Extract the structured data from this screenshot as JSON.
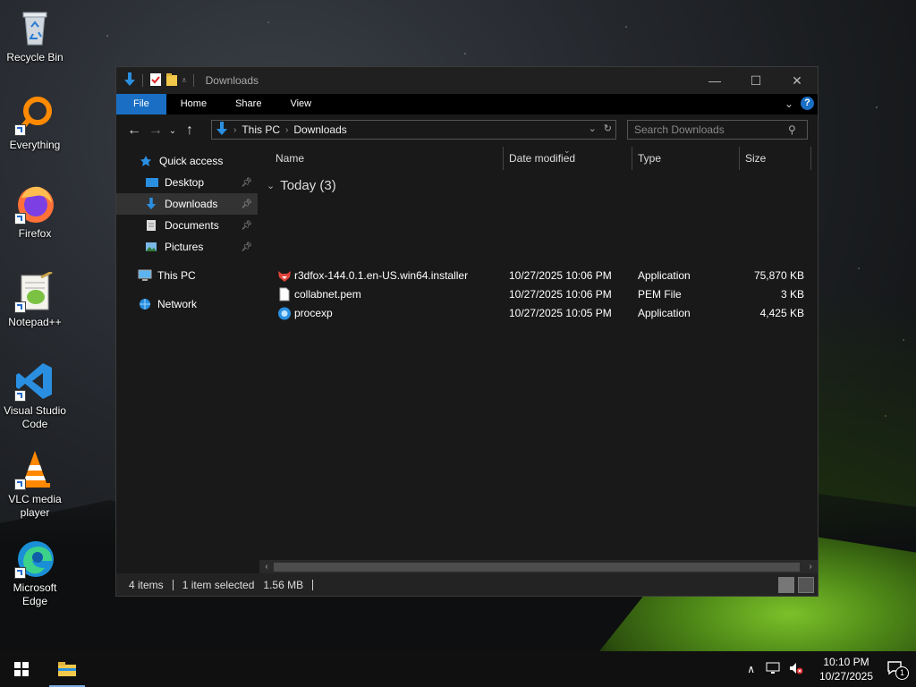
{
  "desktop": {
    "icons": [
      {
        "label": "Recycle Bin"
      },
      {
        "label": "Everything"
      },
      {
        "label": "Firefox"
      },
      {
        "label": "Notepad++"
      },
      {
        "label": "Visual Studio Code"
      },
      {
        "label": "VLC media player"
      },
      {
        "label": "Microsoft Edge"
      }
    ]
  },
  "window": {
    "title": "Downloads",
    "controls": {
      "minimize": "—",
      "maximize": "☐",
      "close": "✕"
    },
    "ribbon_tabs": [
      "File",
      "Home",
      "Share",
      "View"
    ],
    "help": "?",
    "address": {
      "crumbs": [
        "This PC",
        "Downloads"
      ]
    },
    "search": {
      "placeholder": "Search Downloads"
    }
  },
  "nav_pane": {
    "quick_access": "Quick access",
    "items": [
      {
        "label": "Desktop",
        "pinned": true
      },
      {
        "label": "Downloads",
        "pinned": true,
        "selected": true
      },
      {
        "label": "Documents",
        "pinned": true
      },
      {
        "label": "Pictures",
        "pinned": true
      }
    ],
    "this_pc": "This PC",
    "network": "Network"
  },
  "file_list": {
    "columns": {
      "name": "Name",
      "date": "Date modified",
      "type": "Type",
      "size": "Size"
    },
    "group": "Today (3)",
    "rows": [
      {
        "name": "r3dfox-144.0.1.en-US.win64.installer",
        "date": "10/27/2025 10:06 PM",
        "type": "Application",
        "size": "75,870 KB",
        "icon": "fox-installer-icon"
      },
      {
        "name": "collabnet.pem",
        "date": "10/27/2025 10:06 PM",
        "type": "PEM File",
        "size": "3 KB",
        "icon": "document-icon"
      },
      {
        "name": "procexp",
        "date": "10/27/2025 10:05 PM",
        "type": "Application",
        "size": "4,425 KB",
        "icon": "process-explorer-icon"
      }
    ]
  },
  "status_bar": {
    "count": "4 items",
    "selection": "1 item selected",
    "size": "1.56 MB"
  },
  "taskbar": {
    "time": "10:10 PM",
    "date": "10/27/2025",
    "notification_count": "1"
  },
  "colors": {
    "accent": "#1a6fc4",
    "window_bg": "#191919",
    "selected": "#333333"
  }
}
